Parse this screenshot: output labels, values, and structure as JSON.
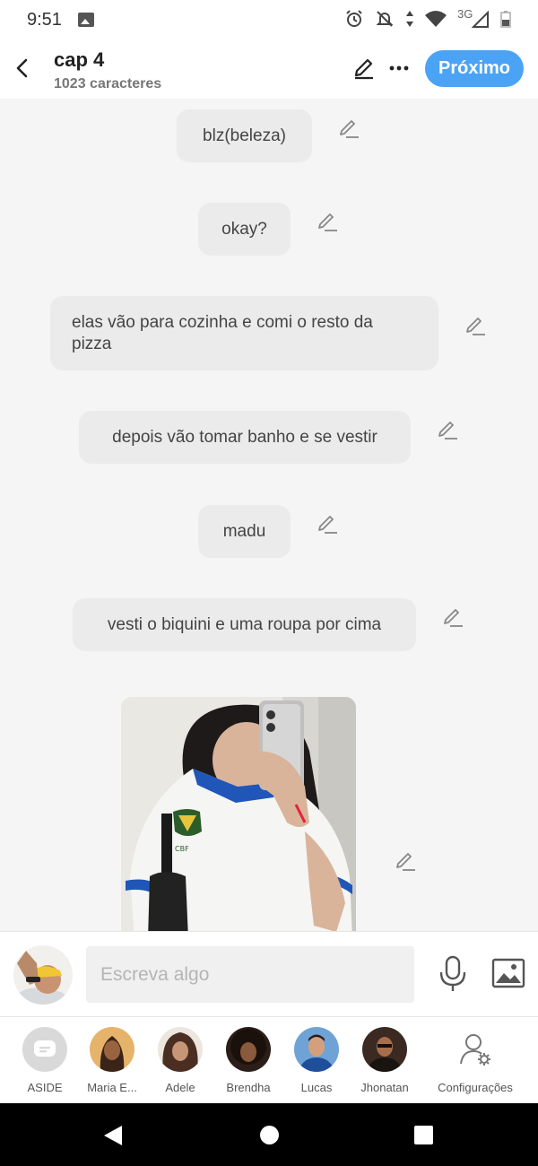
{
  "status_bar": {
    "time": "9:51",
    "network": "3G"
  },
  "header": {
    "title": "cap 4",
    "subtitle": "1023 caracteres",
    "next_label": "Próximo"
  },
  "messages": [
    {
      "text": "blz(beleza)"
    },
    {
      "text": "okay?"
    },
    {
      "text": "elas vão para cozinha e comi o resto da pizza"
    },
    {
      "text": "depois vão tomar banho e se vestir"
    },
    {
      "text": "madu"
    },
    {
      "text": "vesti o biquini e uma roupa por cima"
    }
  ],
  "composer": {
    "placeholder": "Escreva algo"
  },
  "characters": [
    {
      "name": "ASIDE",
      "icon": "chat-bubble-icon"
    },
    {
      "name": "Maria E...",
      "color": "#c9905a"
    },
    {
      "name": "Adele",
      "color": "#6a4a3a"
    },
    {
      "name": "Brendha",
      "color": "#3b2a24"
    },
    {
      "name": "Lucas",
      "color": "#3a6aa8"
    },
    {
      "name": "Jhonatan",
      "color": "#2e2420"
    }
  ],
  "settings_label": "Configurações",
  "colors": {
    "accent": "#4aa3f5",
    "bubble": "#ebebeb",
    "background": "#f5f5f5"
  }
}
